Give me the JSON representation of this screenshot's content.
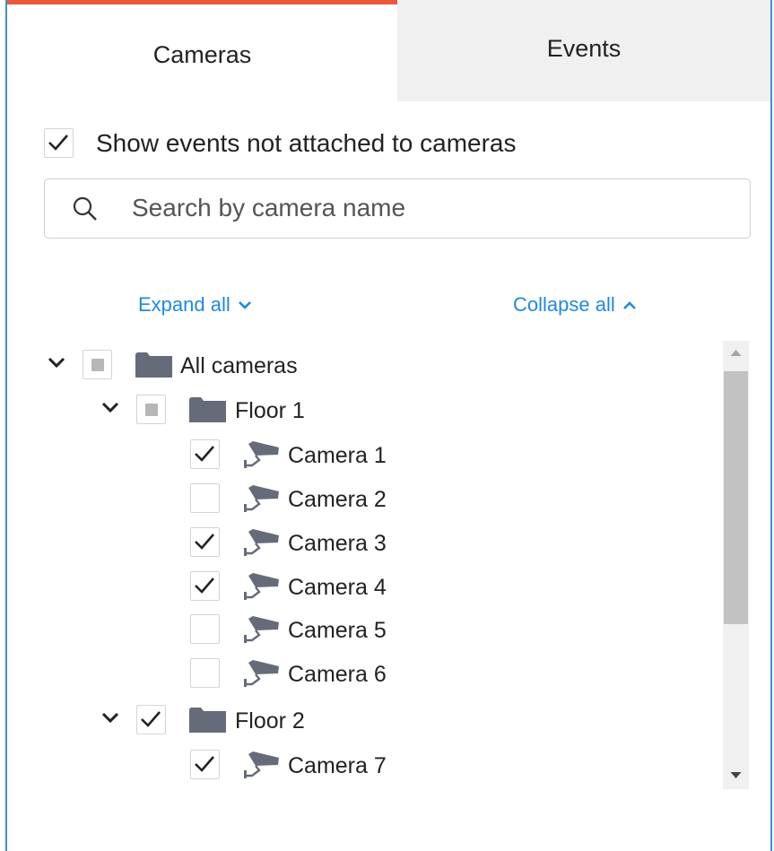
{
  "tabs": {
    "cameras": "Cameras",
    "events": "Events",
    "active": "Cameras",
    "accent_color": "#e8573c"
  },
  "show_events": {
    "label": "Show events not attached to cameras",
    "checked": true
  },
  "search": {
    "placeholder": "Search by camera name",
    "value": ""
  },
  "links": {
    "expand_all": "Expand all",
    "collapse_all": "Collapse all",
    "color": "#1e88e5"
  },
  "tree": {
    "root": {
      "label": "All cameras",
      "state": "partial",
      "expanded": true
    },
    "floor1": {
      "label": "Floor 1",
      "state": "partial",
      "expanded": true
    },
    "cameras_floor1": [
      {
        "label": "Camera 1",
        "checked": true
      },
      {
        "label": "Camera 2",
        "checked": false
      },
      {
        "label": "Camera 3",
        "checked": true
      },
      {
        "label": "Camera 4",
        "checked": true
      },
      {
        "label": "Camera 5",
        "checked": false
      },
      {
        "label": "Camera 6",
        "checked": false
      }
    ],
    "floor2": {
      "label": "Floor 2",
      "state": "checked",
      "expanded": true
    },
    "cameras_floor2": [
      {
        "label": "Camera 7",
        "checked": true
      }
    ]
  },
  "icons": {
    "check": "check-icon",
    "search": "search-icon",
    "chevron_down": "chevron-down-icon",
    "chevron_up": "chevron-up-icon",
    "folder": "folder-icon",
    "camera": "camera-icon"
  }
}
